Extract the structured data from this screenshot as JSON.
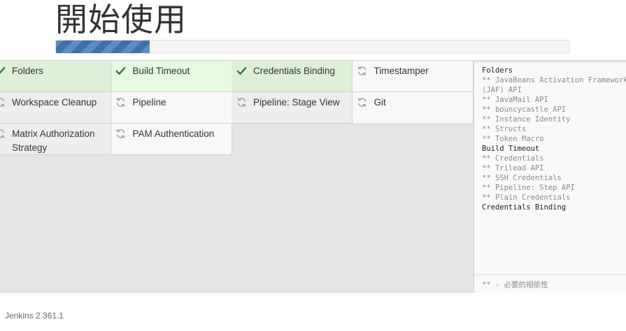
{
  "page": {
    "title": "開始使用",
    "progress_percent": 18.3,
    "footer_version": "Jenkins 2.361.1"
  },
  "colors": {
    "accent": "#3a73ad",
    "check_green": "#3c763d",
    "pending_icon": "#9aa6b2"
  },
  "plugins": [
    {
      "label": "Folders",
      "status": "done",
      "icon": "check-icon"
    },
    {
      "label": "Build Timeout",
      "status": "done",
      "icon": "check-icon"
    },
    {
      "label": "Credentials Binding",
      "status": "done",
      "icon": "check-icon"
    },
    {
      "label": "Timestamper",
      "status": "pending",
      "icon": "refresh-icon"
    },
    {
      "label": "Workspace Cleanup",
      "status": "pending",
      "icon": "refresh-icon"
    },
    {
      "label": "Pipeline",
      "status": "pending",
      "icon": "refresh-icon"
    },
    {
      "label": "Pipeline: Stage View",
      "status": "pending",
      "icon": "refresh-icon"
    },
    {
      "label": "Git",
      "status": "pending",
      "icon": "refresh-icon"
    },
    {
      "label": "Matrix Authorization Strategy",
      "status": "pending",
      "icon": "refresh-icon"
    },
    {
      "label": "PAM Authentication",
      "status": "pending",
      "icon": "refresh-icon"
    }
  ],
  "log": {
    "lines": [
      {
        "text": "Folders",
        "kind": "main"
      },
      {
        "text": "** JavaBeans Activation Framework",
        "kind": "dep"
      },
      {
        "text": "(JAF) API",
        "kind": "dep"
      },
      {
        "text": "** JavaMail API",
        "kind": "dep"
      },
      {
        "text": "** bouncycastle API",
        "kind": "dep"
      },
      {
        "text": "** Instance Identity",
        "kind": "dep"
      },
      {
        "text": "** Structs",
        "kind": "dep"
      },
      {
        "text": "** Token Macro",
        "kind": "dep"
      },
      {
        "text": "Build Timeout",
        "kind": "main"
      },
      {
        "text": "** Credentials",
        "kind": "dep"
      },
      {
        "text": "** Trilead API",
        "kind": "dep"
      },
      {
        "text": "** SSH Credentials",
        "kind": "dep"
      },
      {
        "text": "** Pipeline: Step API",
        "kind": "dep"
      },
      {
        "text": "** Plain Credentials",
        "kind": "dep"
      },
      {
        "text": "Credentials Binding",
        "kind": "main"
      }
    ],
    "legend": "** - 必要的相依性"
  }
}
